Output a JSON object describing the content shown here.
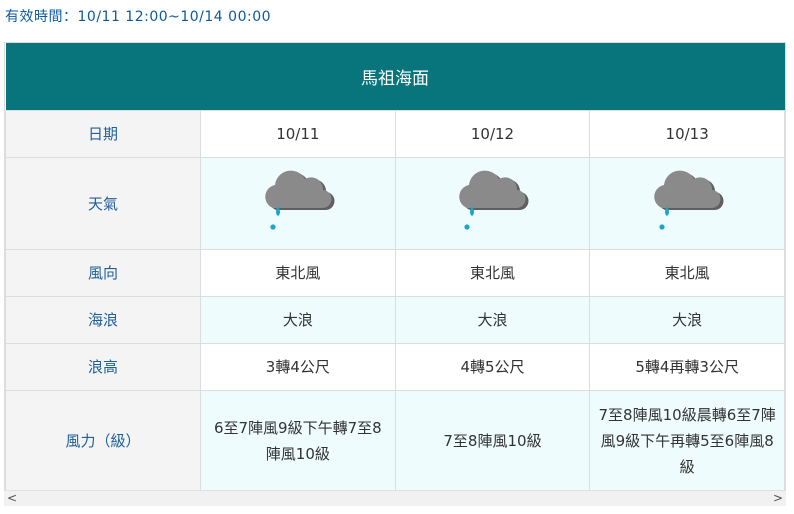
{
  "validity": "有效時間：10/11 12:00~10/14 00:00",
  "table": {
    "title": "馬祖海面",
    "row_labels": {
      "date": "日期",
      "weather": "天氣",
      "wind_dir": "風向",
      "wave": "海浪",
      "wave_height": "浪高",
      "wind_force": "風力（級）"
    },
    "columns": [
      {
        "date": "10/11",
        "weather_icon": "rain-cloud-icon",
        "wind_dir": "東北風",
        "wave": "大浪",
        "wave_height": "3轉4公尺",
        "wind_force": "6至7陣風9級下午轉7至8陣風10級"
      },
      {
        "date": "10/12",
        "weather_icon": "rain-cloud-icon",
        "wind_dir": "東北風",
        "wave": "大浪",
        "wave_height": "4轉5公尺",
        "wind_force": "7至8陣風10級"
      },
      {
        "date": "10/13",
        "weather_icon": "rain-cloud-icon",
        "wind_dir": "東北風",
        "wave": "大浪",
        "wave_height": "5轉4再轉3公尺",
        "wind_force": "7至8陣風10級晨轉6至7陣風9級下午再轉5至6陣風8級"
      }
    ]
  },
  "colors": {
    "header_bg": "#08747c",
    "label_text": "#1f5f9a",
    "alt_row_bg": "#effcfd",
    "cloud": "#8a8a8a",
    "rain": "#1aa6c8"
  },
  "scrollbar": {
    "left_arrow": "<",
    "right_arrow": ">"
  }
}
